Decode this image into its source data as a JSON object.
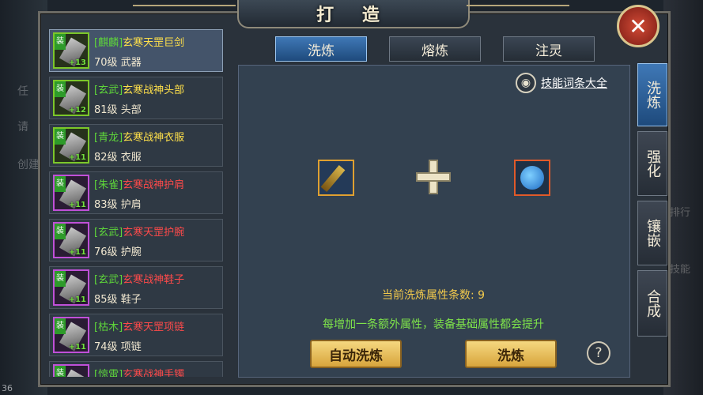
{
  "title": "打 造",
  "close_label": "✕",
  "items": [
    {
      "prefix": "[麒麟]",
      "name": "玄寒天罡巨剑",
      "level_text": "70级",
      "slot": "武器",
      "plus": "+13",
      "tag": "装",
      "quality": "green",
      "name_color": "yellow",
      "selected": true
    },
    {
      "prefix": "[玄武]",
      "name": "玄寒战神头部",
      "level_text": "81级",
      "slot": "头部",
      "plus": "+12",
      "tag": "装",
      "quality": "green",
      "name_color": "yellow"
    },
    {
      "prefix": "[青龙]",
      "name": "玄寒战神衣服",
      "level_text": "82级",
      "slot": "衣服",
      "plus": "+11",
      "tag": "装",
      "quality": "green",
      "name_color": "yellow"
    },
    {
      "prefix": "[朱雀]",
      "name": "玄寒战神护肩",
      "level_text": "83级",
      "slot": "护肩",
      "plus": "+11",
      "tag": "装",
      "quality": "purple",
      "name_color": "red"
    },
    {
      "prefix": "[玄武]",
      "name": "玄寒天罡护腕",
      "level_text": "76级",
      "slot": "护腕",
      "plus": "+11",
      "tag": "装",
      "quality": "purple",
      "name_color": "red"
    },
    {
      "prefix": "[玄武]",
      "name": "玄寒战神鞋子",
      "level_text": "85级",
      "slot": "鞋子",
      "plus": "+11",
      "tag": "装",
      "quality": "purple",
      "name_color": "red"
    },
    {
      "prefix": "[枯木]",
      "name": "玄寒天罡项链",
      "level_text": "74级",
      "slot": "项链",
      "plus": "+11",
      "tag": "装",
      "quality": "purple",
      "name_color": "red"
    },
    {
      "prefix": "[惊雷]",
      "name": "玄寒战神手镯",
      "level_text": "",
      "slot": "",
      "plus": "",
      "tag": "装",
      "quality": "purple",
      "name_color": "red"
    }
  ],
  "tabs": [
    {
      "label": "洗炼",
      "active": true
    },
    {
      "label": "熔炼",
      "active": false
    },
    {
      "label": "注灵",
      "active": false
    }
  ],
  "skill_link": "技能词条大全",
  "count_text": "当前洗炼属性条数: 9",
  "hint_text": "每增加一条额外属性，装备基础属性都会提升",
  "buttons": {
    "auto": "自动洗炼",
    "refine": "洗炼",
    "help": "?"
  },
  "side_tabs": [
    {
      "label": "洗炼",
      "active": true
    },
    {
      "label": "强化",
      "active": false
    },
    {
      "label": "镶嵌",
      "active": false
    },
    {
      "label": "合成",
      "active": false
    }
  ],
  "bg_texts": {
    "left_1": "任",
    "left_2": "请",
    "left_3": "创建",
    "right_1": "排行",
    "right_2": "技能",
    "corner": "36"
  }
}
